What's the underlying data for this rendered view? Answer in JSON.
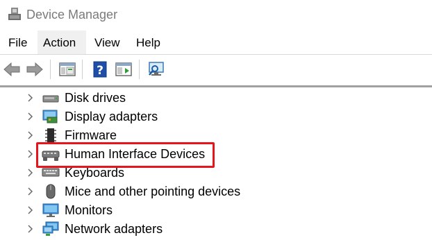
{
  "window": {
    "title": "Device Manager",
    "app_icon": "device-manager-icon"
  },
  "menu": {
    "items": [
      {
        "label": "File"
      },
      {
        "label": "Action"
      },
      {
        "label": "View"
      },
      {
        "label": "Help"
      }
    ]
  },
  "toolbar": {
    "buttons": [
      {
        "icon": "back-arrow-icon"
      },
      {
        "icon": "forward-arrow-icon"
      },
      {
        "icon": "properties-icon"
      },
      {
        "icon": "help-icon"
      },
      {
        "icon": "run-pane-icon"
      },
      {
        "icon": "scan-hardware-icon"
      }
    ]
  },
  "tree": {
    "items": [
      {
        "label": "Disk drives",
        "icon": "disk-drive-icon"
      },
      {
        "label": "Display adapters",
        "icon": "display-adapter-icon"
      },
      {
        "label": "Firmware",
        "icon": "firmware-chip-icon"
      },
      {
        "label": "Human Interface Devices",
        "icon": "hid-icon",
        "highlighted": true
      },
      {
        "label": "Keyboards",
        "icon": "keyboard-icon"
      },
      {
        "label": "Mice and other pointing devices",
        "icon": "mouse-icon"
      },
      {
        "label": "Monitors",
        "icon": "monitor-icon"
      },
      {
        "label": "Network adapters",
        "icon": "network-adapter-icon"
      }
    ]
  },
  "colors": {
    "highlight_border": "#e8141c",
    "title_text": "#7a7a7a",
    "menu_active_bg": "#f0f0f0"
  }
}
